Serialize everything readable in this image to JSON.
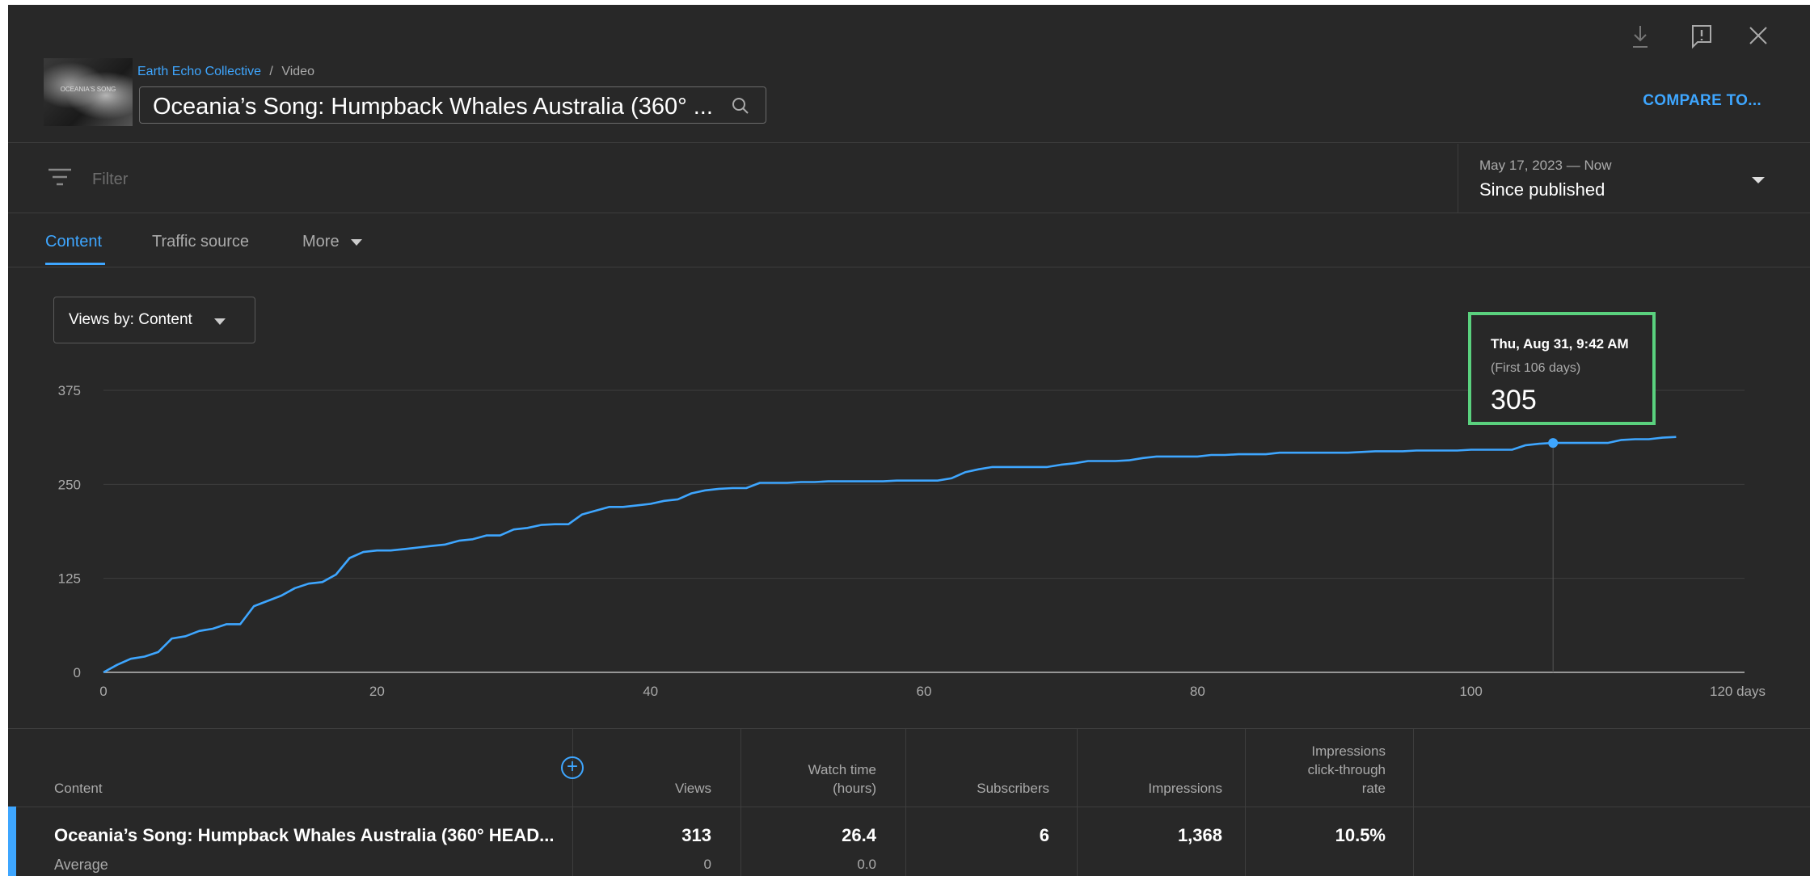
{
  "header": {
    "channel": "Earth Echo Collective",
    "separator": "/",
    "section": "Video",
    "video_title": "Oceania’s Song: Humpback Whales Australia (360° ...",
    "thumbnail_text": "OCEANIA'S SONG",
    "compare_label": "COMPARE TO..."
  },
  "toolbar_icons": [
    "download-icon",
    "feedback-icon",
    "close-icon"
  ],
  "filter": {
    "placeholder": "Filter"
  },
  "date_range": {
    "range": "May 17, 2023 — Now",
    "label": "Since published"
  },
  "tabs": [
    {
      "label": "Content",
      "active": true
    },
    {
      "label": "Traffic source",
      "active": false
    },
    {
      "label": "More",
      "active": false
    }
  ],
  "views_dropdown": {
    "label": "Views by: Content"
  },
  "tooltip": {
    "date": "Thu, Aug 31, 9:42 AM",
    "subtitle": "(First 106 days)",
    "value": "305"
  },
  "chart_data": {
    "type": "line",
    "x_unit_label": "120 days",
    "x_ticks": [
      "0",
      "20",
      "40",
      "60",
      "80",
      "100"
    ],
    "y_ticks": [
      "0",
      "125",
      "250",
      "375"
    ],
    "xlim": [
      0,
      120
    ],
    "ylim": [
      0,
      375
    ],
    "grid": true,
    "color": "#3ea6ff",
    "highlight": {
      "x": 106,
      "y": 305
    },
    "series": [
      {
        "x": [
          0,
          1,
          2,
          3,
          4,
          5,
          6,
          7,
          8,
          9,
          10,
          11,
          12,
          13,
          14,
          15,
          16,
          17,
          18,
          19,
          20,
          21,
          22,
          23,
          24,
          25,
          26,
          27,
          28,
          29,
          30,
          31,
          32,
          33,
          34,
          35,
          36,
          37,
          38,
          39,
          40,
          41,
          42,
          43,
          44,
          45,
          46,
          47,
          48,
          49,
          50,
          51,
          52,
          53,
          54,
          55,
          56,
          57,
          58,
          59,
          60,
          61,
          62,
          63,
          64,
          65,
          66,
          67,
          68,
          69,
          70,
          71,
          72,
          73,
          74,
          75,
          76,
          77,
          78,
          79,
          80,
          81,
          82,
          83,
          84,
          85,
          86,
          87,
          88,
          89,
          90,
          91,
          92,
          93,
          94,
          95,
          96,
          97,
          98,
          99,
          100,
          101,
          102,
          103,
          104,
          105,
          106,
          107,
          108,
          109,
          110,
          111,
          112,
          113,
          114,
          115
        ],
        "values": [
          0,
          10,
          18,
          21,
          27,
          45,
          48,
          55,
          58,
          64,
          64,
          88,
          95,
          102,
          112,
          118,
          120,
          130,
          152,
          160,
          162,
          162,
          164,
          166,
          168,
          170,
          175,
          177,
          182,
          182,
          190,
          192,
          196,
          197,
          197,
          210,
          215,
          220,
          220,
          222,
          224,
          228,
          230,
          238,
          242,
          244,
          245,
          245,
          252,
          252,
          252,
          253,
          253,
          254,
          254,
          254,
          254,
          254,
          255,
          255,
          255,
          255,
          258,
          266,
          270,
          273,
          273,
          273,
          273,
          273,
          276,
          278,
          281,
          281,
          281,
          282,
          285,
          287,
          287,
          287,
          287,
          289,
          289,
          290,
          290,
          290,
          292,
          292,
          292,
          292,
          292,
          292,
          293,
          294,
          294,
          294,
          295,
          295,
          295,
          295,
          296,
          296,
          296,
          296,
          302,
          304,
          305,
          305,
          305,
          305,
          305,
          309,
          310,
          310,
          312,
          313
        ]
      }
    ]
  },
  "table": {
    "headers": {
      "content": "Content",
      "views": "Views",
      "watch_time_1": "Watch time",
      "watch_time_2": "(hours)",
      "subscribers": "Subscribers",
      "impressions": "Impressions",
      "ctr_1": "Impressions",
      "ctr_2": "click-through",
      "ctr_3": "rate"
    },
    "add_column_label": "+",
    "row": {
      "title": "Oceania’s Song: Humpback Whales Australia (360° HEAD...",
      "average_label": "Average",
      "views": "313",
      "views_avg": "0",
      "watch_time": "26.4",
      "watch_time_avg": "0.0",
      "subscribers": "6",
      "impressions": "1,368",
      "ctr": "10.5%"
    }
  }
}
